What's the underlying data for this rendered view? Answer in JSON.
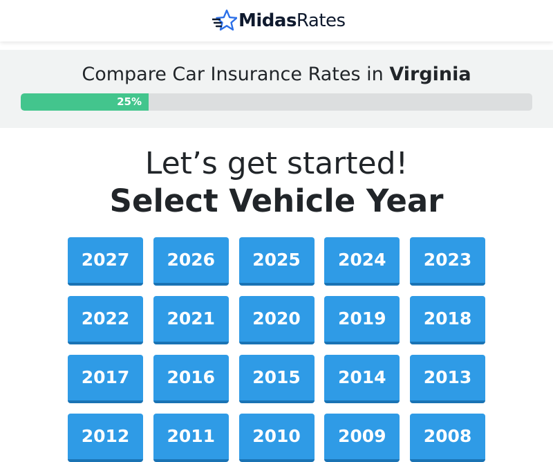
{
  "header": {
    "logo_icon": "star-icon",
    "logo_bold": "Midas",
    "logo_light": "Rates",
    "accent_color": "#2b6fe8"
  },
  "progress": {
    "title_prefix": "Compare Car Insurance Rates in ",
    "title_state": "Virginia",
    "percent": 25,
    "percent_label": "25%",
    "fill_color": "#43c58d",
    "track_color": "#dcdedf"
  },
  "main": {
    "heading": "Let’s get started!",
    "subheading": "Select Vehicle Year",
    "button_color": "#2f9be6",
    "years": [
      "2027",
      "2026",
      "2025",
      "2024",
      "2023",
      "2022",
      "2021",
      "2020",
      "2019",
      "2018",
      "2017",
      "2016",
      "2015",
      "2014",
      "2013",
      "2012",
      "2011",
      "2010",
      "2009",
      "2008"
    ]
  }
}
